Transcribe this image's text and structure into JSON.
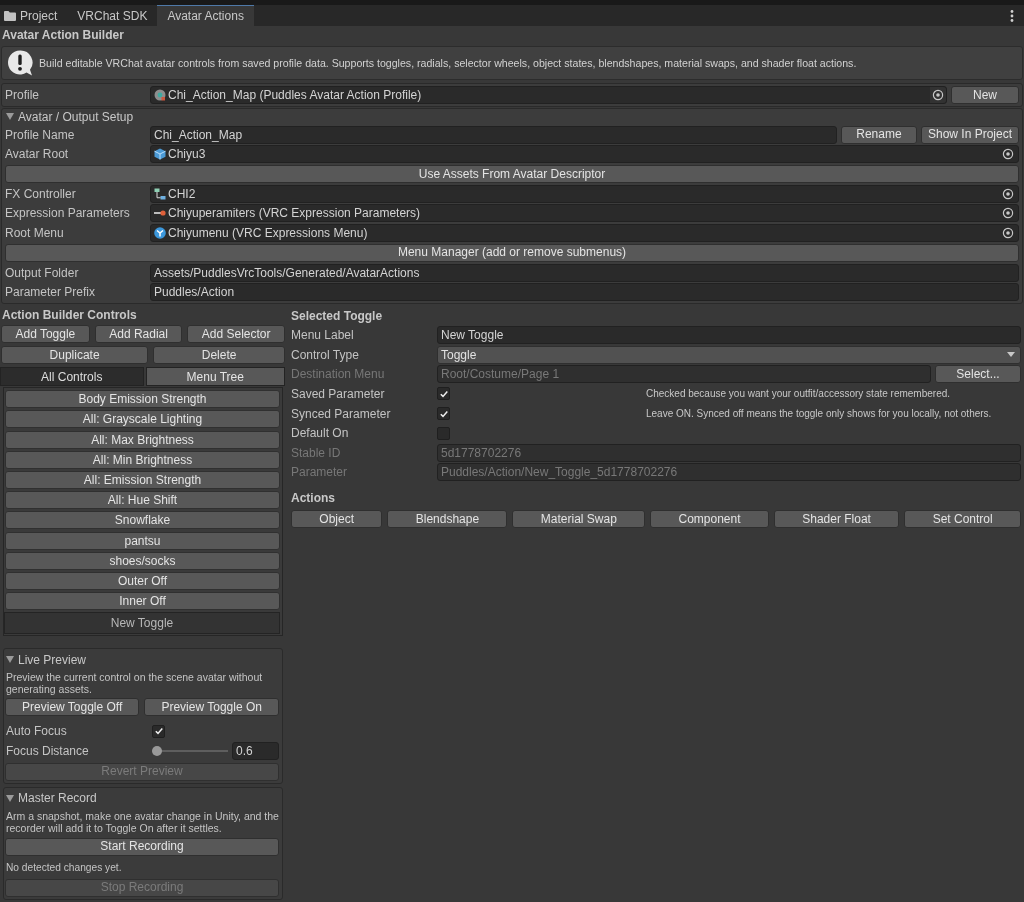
{
  "tabs": [
    {
      "label": "Project",
      "kind": "folder",
      "selected": false
    },
    {
      "label": "VRChat SDK",
      "kind": "plain",
      "selected": false
    },
    {
      "label": "Avatar Actions",
      "kind": "plain",
      "selected": true
    }
  ],
  "title": "Avatar Action Builder",
  "help": "Build editable VRChat avatar controls from saved profile data. Supports toggles, radials, selector wheels, object states, blendshapes, material swaps, and shader float actions.",
  "profile": {
    "label": "Profile",
    "value": "Chi_Action_Map (Puddles Avatar Action Profile)",
    "button": "New"
  },
  "setup": {
    "title": "Avatar / Output Setup",
    "expanded": true,
    "rows": [
      {
        "kind": "text",
        "label": "Profile Name",
        "value": "Chi_Action_Map",
        "buttons": [
          "Rename",
          "Show In Project"
        ]
      },
      {
        "kind": "prefab",
        "label": "Avatar Root",
        "value": "Chiyu3"
      },
      {
        "kind": "button",
        "label": "Use Assets From Avatar Descriptor"
      },
      {
        "kind": "controller",
        "label": "FX Controller",
        "value": "CHI2"
      },
      {
        "kind": "parameters",
        "label": "Expression Parameters",
        "value": "Chiyuperamiters (VRC Expression Parameters)"
      },
      {
        "kind": "menu",
        "label": "Root Menu",
        "value": "Chiyumenu (VRC Expressions Menu)"
      },
      {
        "kind": "button",
        "label": "Menu Manager (add or remove submenus)"
      },
      {
        "kind": "text",
        "label": "Output Folder",
        "value": "Assets/PuddlesVrcTools/Generated/AvatarActions"
      },
      {
        "kind": "text",
        "label": "Parameter Prefix",
        "value": "Puddles/Action"
      }
    ]
  },
  "controls": {
    "title": "Action Builder Controls",
    "button_rows": [
      [
        "Add Toggle",
        "Add Radial",
        "Add Selector"
      ],
      [
        "Duplicate",
        "Delete"
      ]
    ],
    "view_tabs": [
      {
        "label": "All Controls",
        "selected": true
      },
      {
        "label": "Menu Tree",
        "selected": false
      }
    ],
    "items": [
      {
        "label": "Body Emission Strength",
        "selected": false
      },
      {
        "label": "All: Grayscale Lighting",
        "selected": false
      },
      {
        "label": "All: Max Brightness",
        "selected": false
      },
      {
        "label": "All: Min Brightness",
        "selected": false
      },
      {
        "label": "All: Emission Strength",
        "selected": false
      },
      {
        "label": "All: Hue Shift",
        "selected": false
      },
      {
        "label": "Snowflake",
        "selected": false
      },
      {
        "label": "pantsu",
        "selected": false
      },
      {
        "label": "shoes/socks",
        "selected": false
      },
      {
        "label": "Outer Off",
        "selected": false
      },
      {
        "label": "Inner Off",
        "selected": false
      },
      {
        "label": "New Toggle",
        "selected": true
      }
    ]
  },
  "live_preview": {
    "title": "Live Preview",
    "expanded": true,
    "description": "Preview the current control on the scene avatar without generating assets.",
    "buttons": [
      "Preview Toggle Off",
      "Preview Toggle On"
    ],
    "auto_focus": {
      "label": "Auto Focus",
      "checked": true
    },
    "focus_distance": {
      "label": "Focus Distance",
      "level": 0,
      "value": "0.6"
    },
    "revert": {
      "label": "Revert Preview",
      "disabled": true
    }
  },
  "master_record": {
    "title": "Master Record",
    "expanded": true,
    "description": "Arm a snapshot, make one avatar change in Unity, and the recorder will add it to Toggle On after it settles.",
    "start": {
      "label": "Start Recording",
      "disabled": false
    },
    "status": "No detected changes yet.",
    "stop": {
      "label": "Stop Recording",
      "disabled": true
    }
  },
  "selected_toggle": {
    "title": "Selected Toggle",
    "rows": [
      {
        "kind": "text",
        "label": "Menu Label",
        "value": "New Toggle",
        "disabled": false
      },
      {
        "kind": "dropdown",
        "label": "Control Type",
        "value": "Toggle",
        "disabled": false
      },
      {
        "kind": "text",
        "label": "Destination Menu",
        "value": "Root/Costume/Page 1",
        "disabled": true,
        "button": "Select..."
      },
      {
        "kind": "checkbox",
        "label": "Saved Parameter",
        "checked": true,
        "hint": "Checked because you want your outfit/accessory state remembered.",
        "disabled": false
      },
      {
        "kind": "checkbox",
        "label": "Synced Parameter",
        "checked": true,
        "hint": "Leave ON. Synced off means the toggle only shows for you locally, not others.",
        "disabled": false
      },
      {
        "kind": "checkbox",
        "label": "Default On",
        "checked": false,
        "disabled": false
      },
      {
        "kind": "text",
        "label": "Stable ID",
        "value": "5d1778702276",
        "disabled": true
      },
      {
        "kind": "text",
        "label": "Parameter",
        "value": "Puddles/Action/New_Toggle_5d1778702276",
        "disabled": true
      }
    ],
    "actions_title": "Actions",
    "actions": [
      "Object",
      "Blendshape",
      "Material Swap",
      "Component",
      "Shader Float",
      "Set Control"
    ]
  }
}
